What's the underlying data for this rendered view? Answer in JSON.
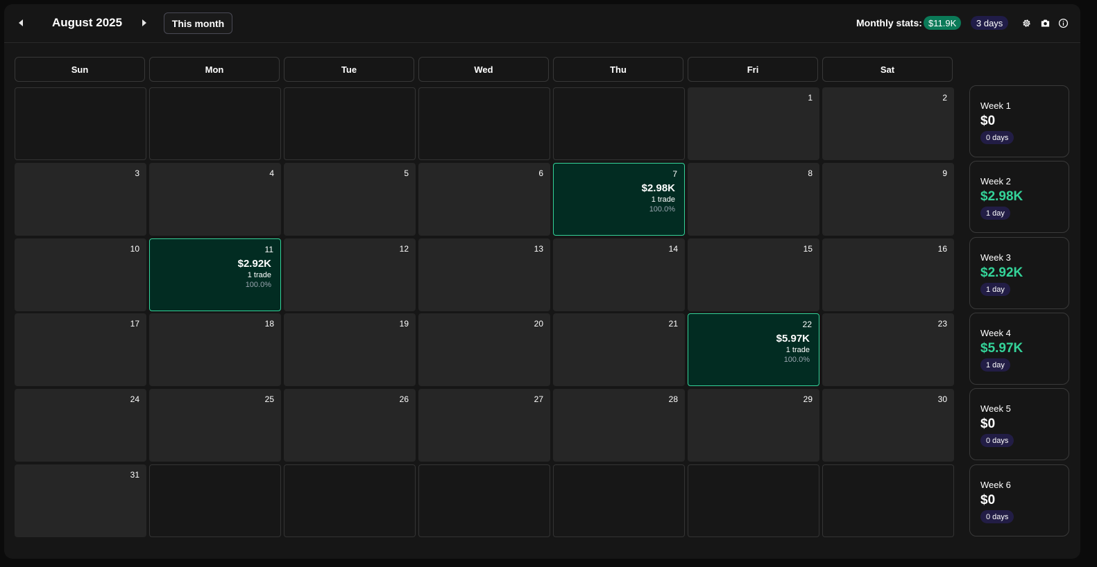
{
  "header": {
    "month_title": "August 2025",
    "this_month_label": "This month",
    "stats_label": "Monthly stats:",
    "stats_pnl": "$11.9K",
    "stats_days": "3 days",
    "icons": [
      "prev-month-icon",
      "next-month-icon",
      "settings-icon",
      "camera-icon",
      "info-icon"
    ]
  },
  "weekdays": [
    "Sun",
    "Mon",
    "Tue",
    "Wed",
    "Thu",
    "Fri",
    "Sat"
  ],
  "days": {
    "d1": {
      "day": "1"
    },
    "d2": {
      "day": "2"
    },
    "d3": {
      "day": "3"
    },
    "d4": {
      "day": "4"
    },
    "d5": {
      "day": "5"
    },
    "d6": {
      "day": "6"
    },
    "d7": {
      "day": "7",
      "pnl": "$2.98K",
      "trades": "1 trade",
      "winrate": "100.0%"
    },
    "d8": {
      "day": "8"
    },
    "d9": {
      "day": "9"
    },
    "d10": {
      "day": "10"
    },
    "d11": {
      "day": "11",
      "pnl": "$2.92K",
      "trades": "1 trade",
      "winrate": "100.0%"
    },
    "d12": {
      "day": "12"
    },
    "d13": {
      "day": "13"
    },
    "d14": {
      "day": "14"
    },
    "d15": {
      "day": "15"
    },
    "d16": {
      "day": "16"
    },
    "d17": {
      "day": "17"
    },
    "d18": {
      "day": "18"
    },
    "d19": {
      "day": "19"
    },
    "d20": {
      "day": "20"
    },
    "d21": {
      "day": "21"
    },
    "d22": {
      "day": "22",
      "pnl": "$5.97K",
      "trades": "1 trade",
      "winrate": "100.0%"
    },
    "d23": {
      "day": "23"
    },
    "d24": {
      "day": "24"
    },
    "d25": {
      "day": "25"
    },
    "d26": {
      "day": "26"
    },
    "d27": {
      "day": "27"
    },
    "d28": {
      "day": "28"
    },
    "d29": {
      "day": "29"
    },
    "d30": {
      "day": "30"
    },
    "d31": {
      "day": "31"
    }
  },
  "weeks": [
    {
      "label": "Week 1",
      "pnl": "$0",
      "days": "0 days"
    },
    {
      "label": "Week 2",
      "pnl": "$2.98K",
      "days": "1 day"
    },
    {
      "label": "Week 3",
      "pnl": "$2.92K",
      "days": "1 day"
    },
    {
      "label": "Week 4",
      "pnl": "$5.97K",
      "days": "1 day"
    },
    {
      "label": "Week 5",
      "pnl": "$0",
      "days": "0 days"
    },
    {
      "label": "Week 6",
      "pnl": "$0",
      "days": "0 days"
    }
  ],
  "colors": {
    "profit_cell_bg": "#022c22",
    "profit_accent": "#34d399",
    "stats_pnl_bg": "#0b7a58",
    "days_badge_bg": "#201c48"
  }
}
